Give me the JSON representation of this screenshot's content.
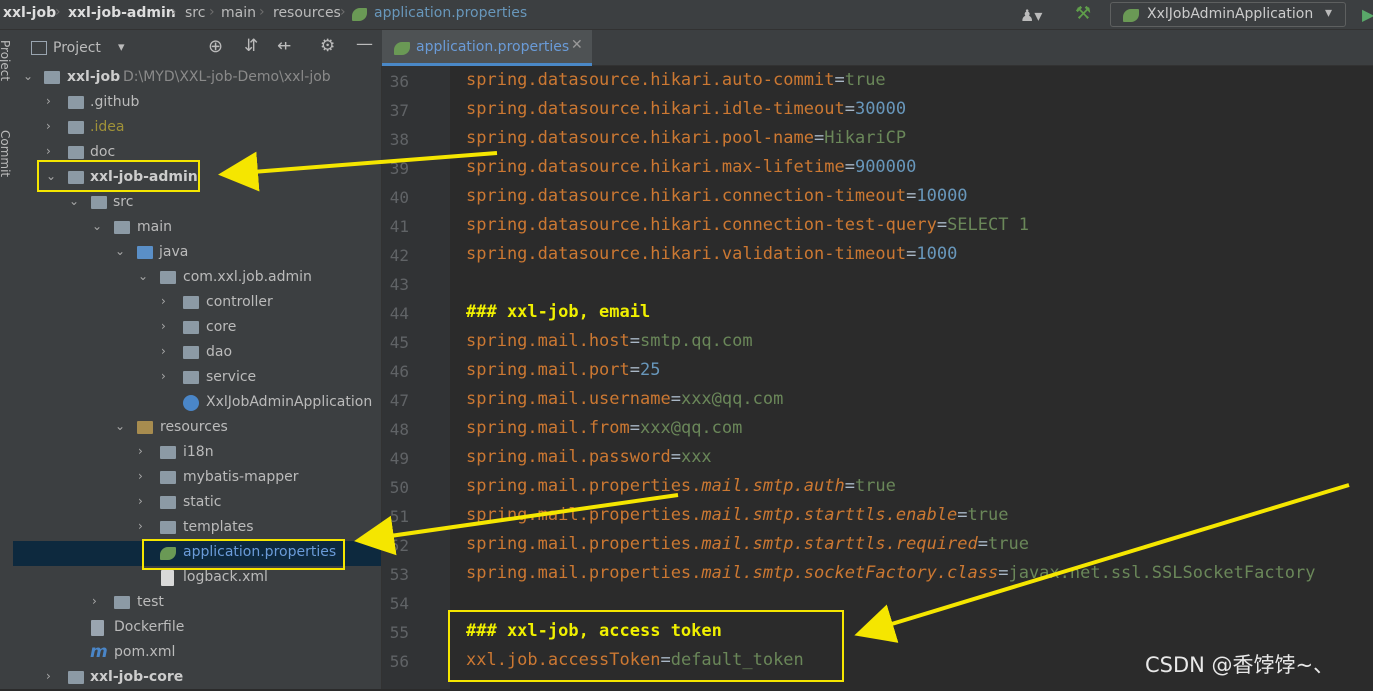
{
  "breadcrumb": [
    "xxl-job",
    "xxl-job-admin",
    "src",
    "main",
    "resources",
    "application.properties"
  ],
  "run_config": {
    "label": "XxlJobAdminApplication"
  },
  "left_strip": {
    "project_label": "Project",
    "commit_label": "Commit"
  },
  "project_panel": {
    "title": "Project",
    "tree": [
      {
        "label": "xxl-job",
        "hint": "D:\\MYD\\XXL-job-Demo\\xxl-job"
      },
      {
        "label": ".github"
      },
      {
        "label": ".idea"
      },
      {
        "label": "doc"
      },
      {
        "label": "xxl-job-admin"
      },
      {
        "label": "src"
      },
      {
        "label": "main"
      },
      {
        "label": "java"
      },
      {
        "label": "com.xxl.job.admin"
      },
      {
        "label": "controller"
      },
      {
        "label": "core"
      },
      {
        "label": "dao"
      },
      {
        "label": "service"
      },
      {
        "label": "XxlJobAdminApplication"
      },
      {
        "label": "resources"
      },
      {
        "label": "i18n"
      },
      {
        "label": "mybatis-mapper"
      },
      {
        "label": "static"
      },
      {
        "label": "templates"
      },
      {
        "label": "application.properties"
      },
      {
        "label": "logback.xml"
      },
      {
        "label": "test"
      },
      {
        "label": "Dockerfile"
      },
      {
        "label": "pom.xml"
      },
      {
        "label": "xxl-job-core"
      }
    ]
  },
  "editor": {
    "tab_label": "application.properties",
    "lines": [
      {
        "num": "36",
        "key": "spring.datasource.hikari.auto-commit",
        "val": "true"
      },
      {
        "num": "37",
        "key": "spring.datasource.hikari.idle-timeout",
        "val": "30000"
      },
      {
        "num": "38",
        "key": "spring.datasource.hikari.pool-name",
        "val": "HikariCP"
      },
      {
        "num": "39",
        "key": "spring.datasource.hikari.max-lifetime",
        "val": "900000"
      },
      {
        "num": "40",
        "key": "spring.datasource.hikari.connection-timeout",
        "val": "10000"
      },
      {
        "num": "41",
        "key": "spring.datasource.hikari.connection-test-query",
        "val": "SELECT 1"
      },
      {
        "num": "42",
        "key": "spring.datasource.hikari.validation-timeout",
        "val": "1000"
      },
      {
        "num": "43",
        "key": "",
        "val": ""
      },
      {
        "num": "44",
        "comment": "### xxl-job, email"
      },
      {
        "num": "45",
        "key": "spring.mail.host",
        "val": "smtp.qq.com"
      },
      {
        "num": "46",
        "key": "spring.mail.port",
        "val": "25"
      },
      {
        "num": "47",
        "key": "spring.mail.username",
        "val": "xxx@qq.com"
      },
      {
        "num": "48",
        "key": "spring.mail.from",
        "val": "xxx@qq.com"
      },
      {
        "num": "49",
        "key": "spring.mail.password",
        "val": "xxx"
      },
      {
        "num": "50",
        "key": "spring.mail.properties.",
        "ikey": "mail.smtp.auth",
        "val": "true"
      },
      {
        "num": "51",
        "key": "spring.mail.properties.",
        "ikey": "mail.smtp.starttls.enable",
        "val": "true"
      },
      {
        "num": "52",
        "key": "spring.mail.properties.",
        "ikey": "mail.smtp.starttls.required",
        "val": "true"
      },
      {
        "num": "53",
        "key": "spring.mail.properties.",
        "ikey": "mail.smtp.socketFactory.class",
        "val": "javax.net.ssl.SSLSocketFactory"
      },
      {
        "num": "54",
        "key": "",
        "val": ""
      },
      {
        "num": "55",
        "comment": "### xxl-job, access token"
      },
      {
        "num": "56",
        "key": "xxl.job.accessToken",
        "val": "default_token"
      }
    ]
  },
  "watermark": "CSDN @香饽饽~、",
  "colors": {
    "annotation": "#f5e600",
    "key": "#cc7832",
    "string": "#6a8759",
    "number": "#6897bb"
  }
}
